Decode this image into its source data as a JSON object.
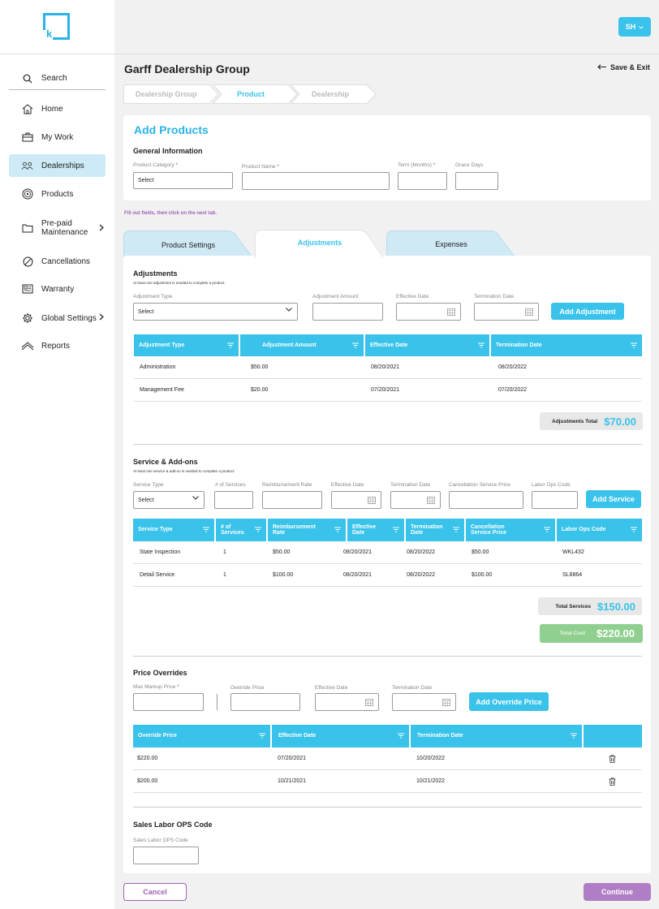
{
  "user": {
    "initials": "SH"
  },
  "nav": [
    {
      "label": "Search",
      "icon": "search-icon"
    },
    {
      "label": "Home",
      "icon": "home-icon"
    },
    {
      "label": "My Work",
      "icon": "briefcase-icon"
    },
    {
      "label": "Dealerships",
      "icon": "people-icon"
    },
    {
      "label": "Products",
      "icon": "tire-icon"
    },
    {
      "label": "Pre-paid",
      "label2": "Maintenance",
      "icon": "folder-icon"
    },
    {
      "label": "Cancellations",
      "icon": "cancel-icon"
    },
    {
      "label": "Warranty",
      "icon": "document-icon"
    },
    {
      "label": "Global Settings",
      "icon": "gear-icon"
    },
    {
      "label": "Reports",
      "icon": "reports-icon"
    }
  ],
  "header": {
    "title": "Garff Dealership Group",
    "save_exit": "Save & Exit"
  },
  "breadcrumb": [
    "Dealership Group",
    "Product",
    "Dealership"
  ],
  "general": {
    "title": "Add Products",
    "section": "General Information",
    "product_category_label": "Product Category",
    "product_category_value": "Select",
    "product_name_label": "Product Name",
    "term_label": "Term (Months)",
    "grace_label": "Grace Days",
    "required_mark": "*"
  },
  "hint": "Fill out fields, then click on the next tab.",
  "tabs": [
    "Product Settings",
    "Adjustments",
    "Expenses"
  ],
  "adjustments": {
    "title": "Adjustments",
    "note": "At least one adjustment is needed to complete a product.",
    "type_label": "Adjustment Type",
    "type_value": "Select",
    "amount_label": "Adjustment Amount",
    "eff_label": "Effective Date",
    "term_label": "Termination Date",
    "add_button": "Add Adjustment",
    "columns": [
      "Adjustment Type",
      "Adjustment Amount",
      "Effective Date",
      "Termination Date"
    ],
    "rows": [
      [
        "Administration",
        "$50.00",
        "08/20/2021",
        "08/20/2022"
      ],
      [
        "Management Fee",
        "$20.00",
        "07/20/2021",
        "07/20/2022"
      ]
    ],
    "total_label": "Adjustments Total",
    "total_value": "$70.00"
  },
  "services": {
    "title": "Service & Add-ons",
    "note": "At least one service & add-on is needed to complete a product.",
    "type_label": "Service Type",
    "type_value": "Select",
    "num_label": "# of Services",
    "rate_label": "Reimbursement Rate",
    "eff_label": "Effective Date",
    "term_label": "Termination Date",
    "cancel_label": "Cancellation Service Price",
    "labor_label": "Labor Ops Code",
    "add_button": "Add Service",
    "columns": [
      {
        "l1": "Service Type",
        "l2": ""
      },
      {
        "l1": "# of",
        "l2": "Services"
      },
      {
        "l1": "Reimbursement",
        "l2": "Rate"
      },
      {
        "l1": "Effective",
        "l2": "Date"
      },
      {
        "l1": "Termination",
        "l2": "Date"
      },
      {
        "l1": "Cancellation",
        "l2": "Service Price"
      },
      {
        "l1": "Labor Ops Code",
        "l2": ""
      }
    ],
    "rows": [
      [
        "State Inspection",
        "1",
        "$50.00",
        "08/20/2021",
        "08/20/2022",
        "$50.00",
        "WKL432"
      ],
      [
        "Detail Service",
        "1",
        "$100.00",
        "08/20/2021",
        "08/20/2022",
        "$100.00",
        "SL8864"
      ]
    ],
    "total_label": "Total Services",
    "total_value": "$150.00",
    "cost_label": "Total Cost",
    "cost_value": "$220.00"
  },
  "overrides": {
    "title": "Price Overrides",
    "max_label": "Max Markup Price",
    "override_label": "Override Price",
    "eff_label": "Effective Date",
    "term_label": "Termination Date",
    "add_button": "Add Override Price",
    "columns": [
      "Override Price",
      "Effective Date",
      "Termination Date"
    ],
    "rows": [
      [
        "$220.00",
        "07/20/2021",
        "10/20/2022"
      ],
      [
        "$200.00",
        "10/21/2021",
        "10/21/2022"
      ]
    ]
  },
  "sales": {
    "title": "Sales Labor OPS Code",
    "label": "Sales Labor OPS Code"
  },
  "footer": {
    "cancel": "Cancel",
    "continue": "Continue"
  }
}
